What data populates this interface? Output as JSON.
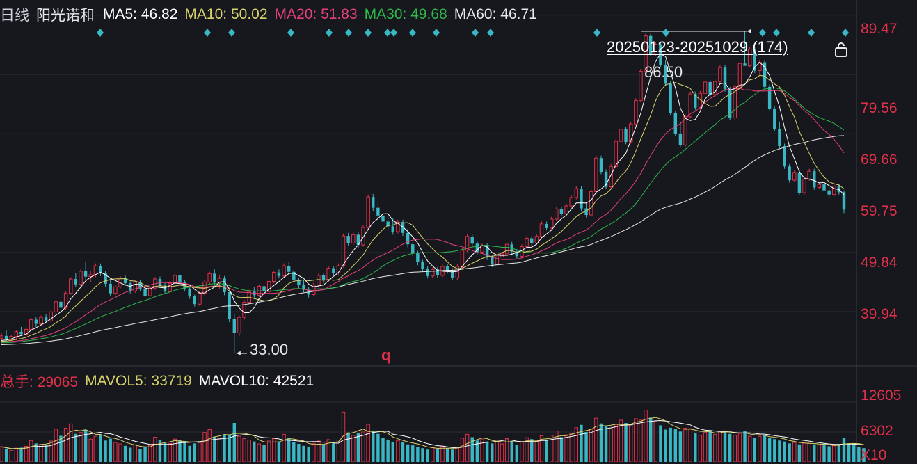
{
  "header": {
    "period": "日线",
    "name": "阳光诺和",
    "ma": [
      {
        "label": "MA5:",
        "value": "46.82",
        "color": "#ffffff"
      },
      {
        "label": "MA10:",
        "value": "50.02",
        "color": "#d9d36b"
      },
      {
        "label": "MA20:",
        "value": "51.83",
        "color": "#e5407a"
      },
      {
        "label": "MA30:",
        "value": "49.68",
        "color": "#2db84b"
      },
      {
        "label": "MA60:",
        "value": "46.71",
        "color": "#e8e8e8"
      }
    ]
  },
  "volume_header": {
    "total_label": "总手:",
    "total_value": "29065",
    "mavol5_label": "MAVOL5:",
    "mavol5_value": "33719",
    "mavol10_label": "MAVOL10:",
    "mavol10_value": "42521"
  },
  "range_badge": "20250123-20251029 (174)",
  "annotations": {
    "high": "86.50",
    "low": "33.00",
    "q_marker": "q"
  },
  "colors": {
    "background": "#17181d",
    "up": "#e2304a",
    "down": "#3ab7c4",
    "grid": "#2a2c33",
    "axis_text": "#e2304a",
    "marker": "#3ab7c4"
  },
  "chart_data": {
    "type": "candlestick",
    "price_axis": {
      "ticks": [
        "89.47",
        "79.56",
        "69.66",
        "59.75",
        "49.84",
        "39.94"
      ],
      "range": [
        31.0,
        92.0
      ]
    },
    "volume_axis": {
      "ticks": [
        "12605",
        "6302",
        "X10"
      ],
      "range": [
        0,
        14500
      ]
    },
    "candles": [
      [
        35.5,
        36.4,
        34.6,
        35.9
      ],
      [
        35.9,
        36.8,
        35.0,
        35.3
      ],
      [
        35.3,
        36.0,
        34.8,
        35.8
      ],
      [
        35.8,
        36.9,
        35.2,
        36.6
      ],
      [
        36.6,
        37.4,
        36.0,
        36.2
      ],
      [
        36.2,
        37.5,
        35.8,
        37.0
      ],
      [
        37.0,
        38.9,
        36.7,
        38.6
      ],
      [
        38.6,
        39.0,
        37.4,
        37.9
      ],
      [
        37.9,
        39.3,
        37.6,
        39.0
      ],
      [
        39.0,
        39.5,
        38.0,
        38.4
      ],
      [
        38.4,
        40.2,
        38.1,
        39.9
      ],
      [
        39.9,
        41.9,
        39.6,
        41.6
      ],
      [
        41.6,
        42.2,
        40.2,
        40.6
      ],
      [
        40.6,
        43.3,
        40.3,
        43.0
      ],
      [
        43.0,
        45.7,
        42.8,
        45.4
      ],
      [
        45.4,
        46.4,
        44.0,
        44.5
      ],
      [
        44.5,
        47.0,
        44.2,
        46.7
      ],
      [
        46.7,
        48.3,
        45.3,
        45.8
      ],
      [
        45.8,
        46.8,
        44.8,
        46.1
      ],
      [
        46.1,
        48.0,
        45.7,
        47.6
      ],
      [
        47.6,
        48.0,
        45.9,
        46.4
      ],
      [
        46.4,
        46.8,
        44.1,
        44.6
      ],
      [
        44.6,
        45.6,
        42.6,
        43.0
      ],
      [
        43.0,
        44.5,
        42.7,
        44.1
      ],
      [
        44.1,
        45.9,
        43.8,
        45.6
      ],
      [
        45.6,
        46.1,
        44.3,
        44.7
      ],
      [
        44.7,
        45.0,
        43.0,
        43.4
      ],
      [
        43.4,
        45.2,
        43.1,
        44.9
      ],
      [
        44.9,
        45.3,
        43.4,
        43.8
      ],
      [
        43.8,
        44.1,
        42.2,
        42.6
      ],
      [
        42.6,
        44.2,
        42.3,
        43.9
      ],
      [
        43.9,
        45.7,
        43.6,
        45.4
      ],
      [
        45.4,
        45.8,
        43.9,
        44.3
      ],
      [
        44.3,
        44.7,
        42.9,
        43.3
      ],
      [
        43.3,
        45.0,
        43.0,
        44.7
      ],
      [
        44.7,
        46.3,
        44.4,
        46.0
      ],
      [
        46.0,
        46.4,
        44.4,
        44.8
      ],
      [
        44.8,
        45.2,
        43.4,
        43.8
      ],
      [
        43.8,
        44.1,
        42.1,
        42.5
      ],
      [
        42.5,
        42.8,
        40.8,
        41.2
      ],
      [
        41.2,
        43.3,
        40.9,
        43.0
      ],
      [
        43.0,
        45.2,
        42.7,
        44.9
      ],
      [
        44.9,
        46.6,
        44.6,
        46.3
      ],
      [
        46.3,
        47.0,
        44.3,
        44.8
      ],
      [
        44.8,
        46.0,
        43.8,
        45.5
      ],
      [
        45.5,
        45.9,
        42.7,
        43.2
      ],
      [
        43.2,
        43.5,
        38.2,
        38.7
      ],
      [
        38.7,
        39.6,
        33.0,
        36.4
      ],
      [
        36.4,
        39.3,
        35.9,
        39.0
      ],
      [
        39.0,
        41.9,
        38.6,
        41.5
      ],
      [
        41.5,
        43.6,
        41.2,
        43.3
      ],
      [
        43.3,
        44.1,
        42.2,
        42.7
      ],
      [
        42.7,
        44.5,
        42.4,
        44.2
      ],
      [
        44.2,
        44.6,
        42.9,
        43.3
      ],
      [
        43.3,
        45.3,
        43.0,
        45.0
      ],
      [
        45.0,
        46.8,
        44.7,
        46.5
      ],
      [
        46.5,
        47.0,
        45.5,
        45.9
      ],
      [
        45.9,
        48.0,
        45.6,
        47.6
      ],
      [
        47.6,
        48.3,
        46.1,
        46.6
      ],
      [
        46.6,
        46.9,
        44.8,
        45.3
      ],
      [
        45.3,
        45.6,
        43.9,
        44.4
      ],
      [
        44.4,
        45.2,
        43.2,
        43.6
      ],
      [
        43.6,
        44.0,
        42.3,
        42.8
      ],
      [
        42.8,
        44.8,
        42.5,
        44.4
      ],
      [
        44.4,
        46.4,
        44.0,
        46.0
      ],
      [
        46.0,
        46.4,
        44.7,
        45.2
      ],
      [
        45.2,
        47.6,
        44.9,
        47.2
      ],
      [
        47.2,
        47.6,
        46.0,
        46.4
      ],
      [
        46.4,
        48.0,
        46.1,
        47.6
      ],
      [
        47.6,
        53.0,
        47.3,
        52.6
      ],
      [
        52.6,
        53.1,
        50.9,
        51.4
      ],
      [
        51.4,
        53.2,
        51.1,
        52.8
      ],
      [
        52.8,
        53.3,
        50.6,
        51.1
      ],
      [
        51.1,
        54.4,
        50.8,
        54.0
      ],
      [
        54.0,
        59.5,
        53.7,
        59.1
      ],
      [
        59.1,
        59.6,
        56.7,
        57.3
      ],
      [
        57.3,
        58.4,
        55.5,
        56.0
      ],
      [
        56.0,
        56.7,
        54.4,
        55.0
      ],
      [
        55.0,
        56.0,
        53.6,
        54.2
      ],
      [
        54.2,
        55.6,
        52.8,
        53.3
      ],
      [
        53.3,
        55.3,
        53.0,
        54.9
      ],
      [
        54.9,
        55.3,
        52.6,
        53.1
      ],
      [
        53.1,
        53.8,
        50.7,
        51.2
      ],
      [
        51.2,
        51.5,
        49.2,
        49.7
      ],
      [
        49.7,
        50.1,
        47.7,
        48.2
      ],
      [
        48.2,
        48.6,
        46.7,
        47.1
      ],
      [
        47.1,
        47.5,
        45.5,
        45.9
      ],
      [
        45.9,
        47.3,
        45.6,
        47.0
      ],
      [
        47.0,
        47.4,
        45.6,
        46.0
      ],
      [
        46.0,
        47.8,
        45.7,
        47.5
      ],
      [
        47.5,
        47.9,
        46.3,
        46.8
      ],
      [
        46.8,
        47.2,
        45.2,
        45.6
      ],
      [
        45.6,
        47.9,
        45.3,
        47.5
      ],
      [
        47.5,
        50.5,
        47.2,
        50.2
      ],
      [
        50.2,
        52.9,
        49.9,
        52.5
      ],
      [
        52.5,
        52.9,
        50.8,
        51.3
      ],
      [
        51.3,
        51.7,
        49.5,
        49.9
      ],
      [
        49.9,
        51.4,
        49.6,
        51.0
      ],
      [
        51.0,
        51.4,
        48.6,
        49.1
      ],
      [
        49.1,
        49.4,
        47.4,
        47.8
      ],
      [
        47.8,
        49.5,
        47.5,
        49.1
      ],
      [
        49.1,
        50.0,
        48.8,
        49.6
      ],
      [
        49.6,
        51.6,
        49.3,
        51.2
      ],
      [
        51.2,
        51.6,
        49.5,
        50.0
      ],
      [
        50.0,
        50.4,
        48.7,
        49.2
      ],
      [
        49.2,
        51.2,
        48.9,
        50.8
      ],
      [
        50.8,
        52.6,
        50.5,
        52.2
      ],
      [
        52.2,
        52.6,
        51.0,
        51.4
      ],
      [
        51.4,
        52.9,
        51.1,
        52.5
      ],
      [
        52.5,
        55.0,
        52.2,
        54.6
      ],
      [
        54.6,
        55.0,
        53.5,
        53.9
      ],
      [
        53.9,
        55.8,
        53.6,
        55.4
      ],
      [
        55.4,
        57.5,
        55.1,
        57.1
      ],
      [
        57.1,
        57.5,
        55.9,
        56.3
      ],
      [
        56.3,
        58.0,
        56.0,
        57.6
      ],
      [
        57.6,
        59.4,
        57.3,
        59.0
      ],
      [
        59.0,
        60.9,
        58.7,
        60.5
      ],
      [
        60.5,
        60.9,
        56.8,
        57.2
      ],
      [
        57.2,
        58.2,
        55.7,
        56.1
      ],
      [
        56.1,
        60.4,
        55.8,
        60.0
      ],
      [
        60.0,
        66.0,
        59.7,
        65.6
      ],
      [
        65.6,
        66.0,
        62.9,
        63.3
      ],
      [
        63.3,
        63.7,
        60.4,
        60.8
      ],
      [
        60.8,
        64.6,
        60.5,
        64.2
      ],
      [
        64.2,
        68.8,
        63.9,
        68.4
      ],
      [
        68.4,
        70.8,
        68.1,
        70.4
      ],
      [
        70.4,
        70.8,
        67.9,
        68.3
      ],
      [
        68.3,
        71.7,
        68.0,
        71.3
      ],
      [
        71.3,
        75.6,
        71.0,
        75.2
      ],
      [
        75.2,
        80.5,
        74.9,
        80.1
      ],
      [
        80.1,
        86.5,
        79.8,
        86.0
      ],
      [
        86.0,
        86.4,
        82.6,
        83.0
      ],
      [
        83.0,
        85.0,
        82.7,
        84.6
      ],
      [
        84.6,
        85.0,
        80.8,
        81.2
      ],
      [
        81.2,
        82.0,
        77.6,
        78.0
      ],
      [
        78.0,
        78.4,
        72.7,
        73.1
      ],
      [
        73.1,
        73.5,
        69.3,
        69.7
      ],
      [
        69.7,
        71.6,
        67.4,
        67.8
      ],
      [
        67.8,
        72.9,
        67.5,
        72.5
      ],
      [
        72.5,
        76.7,
        72.2,
        76.3
      ],
      [
        76.3,
        76.7,
        73.6,
        74.0
      ],
      [
        74.0,
        76.8,
        73.7,
        76.4
      ],
      [
        76.4,
        78.7,
        76.1,
        78.3
      ],
      [
        78.3,
        78.7,
        75.8,
        76.2
      ],
      [
        76.2,
        78.8,
        75.9,
        78.4
      ],
      [
        78.4,
        81.1,
        78.1,
        80.7
      ],
      [
        80.7,
        81.1,
        76.7,
        77.1
      ],
      [
        77.1,
        77.5,
        71.9,
        72.3
      ],
      [
        72.3,
        77.9,
        72.0,
        77.5
      ],
      [
        77.5,
        81.8,
        77.2,
        81.4
      ],
      [
        81.4,
        86.8,
        81.1,
        81.0
      ],
      [
        81.0,
        84.2,
        80.7,
        83.8
      ],
      [
        83.8,
        84.2,
        79.8,
        80.2
      ],
      [
        80.2,
        82.0,
        79.5,
        81.6
      ],
      [
        81.6,
        82.0,
        77.1,
        77.5
      ],
      [
        77.5,
        77.9,
        73.4,
        73.8
      ],
      [
        73.8,
        74.2,
        70.1,
        70.5
      ],
      [
        70.5,
        71.7,
        67.2,
        67.6
      ],
      [
        67.6,
        68.0,
        63.8,
        64.2
      ],
      [
        64.2,
        64.6,
        61.5,
        61.9
      ],
      [
        61.9,
        63.6,
        61.6,
        63.2
      ],
      [
        63.2,
        63.6,
        59.4,
        59.8
      ],
      [
        59.8,
        62.5,
        59.5,
        62.1
      ],
      [
        62.1,
        63.8,
        61.8,
        63.4
      ],
      [
        63.4,
        63.8,
        60.3,
        60.7
      ],
      [
        60.7,
        61.6,
        60.4,
        61.2
      ],
      [
        61.2,
        61.6,
        59.8,
        60.2
      ],
      [
        60.2,
        61.2,
        59.0,
        59.5
      ],
      [
        59.5,
        61.6,
        59.2,
        60.9
      ],
      [
        60.9,
        61.2,
        59.5,
        59.9
      ],
      [
        59.9,
        60.2,
        56.4,
        57.0
      ]
    ],
    "volume_bars": [
      3200,
      2800,
      2400,
      2900,
      3000,
      3300,
      4500,
      3900,
      3700,
      3500,
      4400,
      6900,
      5500,
      7100,
      8000,
      5900,
      6200,
      6700,
      4800,
      5400,
      5800,
      4500,
      4900,
      4100,
      3800,
      3400,
      3000,
      3600,
      2700,
      3200,
      3500,
      5200,
      4600,
      4000,
      3900,
      4800,
      4600,
      4300,
      3400,
      3900,
      4200,
      6200,
      6800,
      5300,
      4900,
      5700,
      5800,
      8200,
      5400,
      4900,
      4600,
      4300,
      3800,
      3600,
      4400,
      4900,
      4300,
      5800,
      5000,
      4100,
      3800,
      3400,
      3200,
      3900,
      4400,
      3600,
      4700,
      3900,
      4600,
      10500,
      6200,
      5600,
      6000,
      6300,
      7900,
      6400,
      5900,
      5100,
      4700,
      4100,
      4500,
      4200,
      3700,
      3500,
      3100,
      2900,
      2600,
      3000,
      2700,
      3300,
      2900,
      2600,
      3100,
      5000,
      5800,
      5200,
      4500,
      4700,
      4300,
      3900,
      4300,
      3800,
      4900,
      4400,
      3600,
      4200,
      5100,
      4800,
      4300,
      5500,
      4700,
      5600,
      6500,
      5200,
      5700,
      6000,
      7200,
      7800,
      6300,
      6900,
      9200,
      8100,
      7500,
      7000,
      7900,
      8800,
      8200,
      7900,
      9100,
      8800,
      10900,
      9300,
      8600,
      7700,
      6800,
      7200,
      6900,
      6400,
      7100,
      7000,
      6100,
      5600,
      6200,
      6700,
      5800,
      6400,
      6600,
      5900,
      5600,
      6000,
      6500,
      5400,
      5100,
      5400,
      5600,
      5000,
      4800,
      4500,
      4300,
      3900,
      4100,
      3700,
      4000,
      3900,
      3700,
      3600,
      3500,
      3300,
      3400,
      3700,
      5000,
      3900,
      3500,
      3100,
      2900
    ],
    "volume_up": [
      1,
      0,
      1,
      1,
      0,
      1,
      1,
      0,
      1,
      0,
      1,
      1,
      0,
      1,
      1,
      0,
      1,
      0,
      1,
      1,
      0,
      0,
      0,
      1,
      1,
      0,
      0,
      1,
      0,
      0,
      1,
      1,
      0,
      0,
      1,
      1,
      0,
      0,
      0,
      0,
      1,
      1,
      1,
      0,
      1,
      0,
      0,
      0,
      1,
      1,
      1,
      0,
      1,
      0,
      1,
      1,
      0,
      1,
      0,
      0,
      0,
      0,
      0,
      1,
      1,
      0,
      1,
      0,
      1,
      1,
      0,
      1,
      0,
      1,
      1,
      0,
      0,
      0,
      0,
      0,
      1,
      0,
      0,
      0,
      0,
      0,
      0,
      1,
      0,
      1,
      0,
      0,
      1,
      1,
      1,
      0,
      0,
      1,
      0,
      0,
      1,
      1,
      1,
      0,
      0,
      1,
      1,
      0,
      1,
      1,
      0,
      1,
      1,
      0,
      1,
      1,
      1,
      0,
      0,
      1,
      1,
      0,
      0,
      1,
      1,
      1,
      0,
      1,
      1,
      1,
      1,
      0,
      1,
      0,
      0,
      0,
      0,
      0,
      1,
      1,
      0,
      1,
      1,
      0,
      1,
      1,
      0,
      0,
      1,
      1,
      0,
      1,
      0,
      1,
      0,
      0,
      0,
      0,
      0,
      0,
      1,
      0,
      1,
      1,
      0,
      1,
      0,
      0,
      1,
      0,
      0,
      0,
      0,
      0,
      0
    ],
    "event_markers_x": [
      144,
      298,
      333,
      418,
      473,
      501,
      529,
      557,
      566,
      593,
      627,
      683,
      705,
      858,
      957,
      1096,
      1116,
      1166,
      1215
    ]
  }
}
